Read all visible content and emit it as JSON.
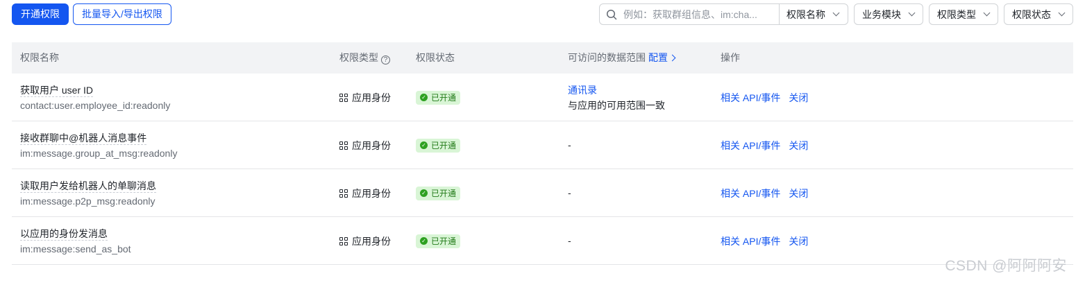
{
  "toolbar": {
    "enable_label": "开通权限",
    "batch_label": "批量导入/导出权限"
  },
  "search": {
    "placeholder": "例如：获取群组信息、im:cha...",
    "field_select": "权限名称"
  },
  "filters": {
    "module": "业务模块",
    "type": "权限类型",
    "status": "权限状态"
  },
  "table": {
    "headers": {
      "name": "权限名称",
      "type": "权限类型",
      "status": "权限状态",
      "scope": "可访问的数据范围",
      "scope_config": "配置",
      "ops": "操作"
    },
    "rows": [
      {
        "name": "获取用户 user ID",
        "code": "contact:user.employee_id:readonly",
        "type": "应用身份",
        "status": "已开通",
        "scope_link": "通讯录",
        "scope_desc": "与应用的可用范围一致",
        "op_api": "相关 API/事件",
        "op_close": "关闭"
      },
      {
        "name": "接收群聊中@机器人消息事件",
        "code": "im:message.group_at_msg:readonly",
        "type": "应用身份",
        "status": "已开通",
        "scope": "-",
        "op_api": "相关 API/事件",
        "op_close": "关闭"
      },
      {
        "name": "读取用户发给机器人的单聊消息",
        "code": "im:message.p2p_msg:readonly",
        "type": "应用身份",
        "status": "已开通",
        "scope": "-",
        "op_api": "相关 API/事件",
        "op_close": "关闭"
      },
      {
        "name": "以应用的身份发消息",
        "code": "im:message:send_as_bot",
        "type": "应用身份",
        "status": "已开通",
        "scope": "-",
        "op_api": "相关 API/事件",
        "op_close": "关闭"
      }
    ]
  },
  "watermark": "CSDN @阿阿阿安",
  "colors": {
    "primary": "#1456f0",
    "header_bg": "#f2f3f5",
    "success_bg": "#d9f5d6",
    "success_text": "#237b19"
  }
}
